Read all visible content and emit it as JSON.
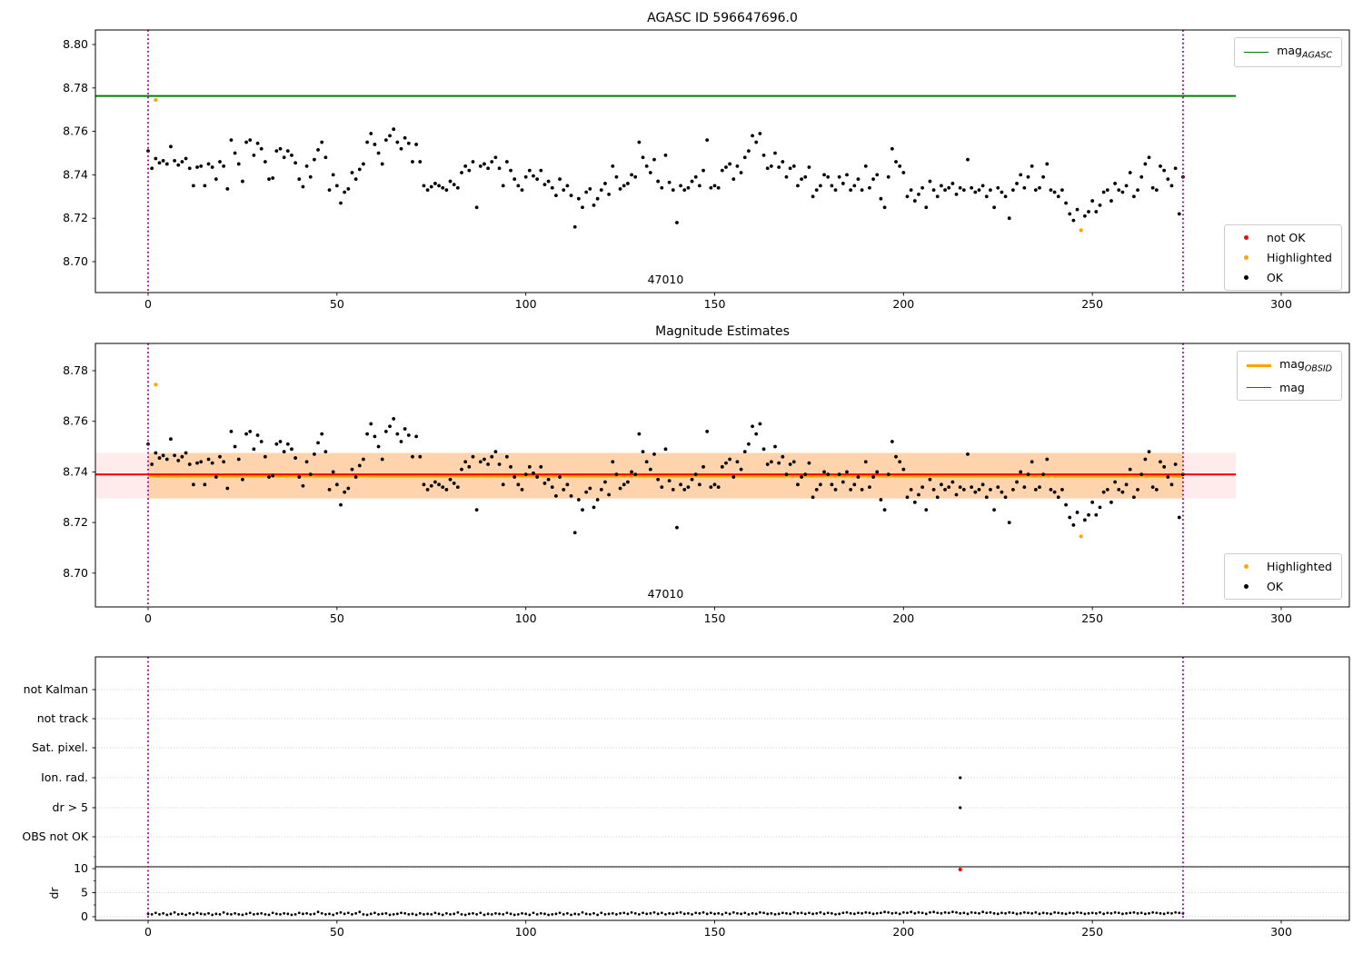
{
  "figure": {
    "background": "#ffffff"
  },
  "colors": {
    "agasc_line": "#007d00",
    "mag_line": "#ff0000",
    "obsid_line": "#ffa500",
    "ok_point": "#000000",
    "not_ok_point": "#ff0000",
    "highlighted_point": "#ffa500",
    "vline": "#990099",
    "band_full": "rgba(255,0,0,0.08)",
    "band_obsid": "rgba(255,160,30,0.30)",
    "grid": "#c8c8c8",
    "threshold_line": "#000000",
    "axis": "#000000"
  },
  "plots": {
    "top": {
      "title": "AGASC ID 596647696.0",
      "obsid_label": {
        "text": "47010",
        "x": 137
      },
      "yticks": [
        "8.70",
        "8.72",
        "8.74",
        "8.76",
        "8.78",
        "8.80"
      ],
      "xticks": [
        0,
        50,
        100,
        150,
        200,
        250,
        300
      ],
      "agasc_line_y": 8.7763,
      "vlines": [
        0,
        274
      ],
      "legend_line": {
        "label": "mag",
        "sub": "AGASC"
      },
      "legend_markers": [
        {
          "label": "not OK",
          "color": "#ff0000"
        },
        {
          "label": "Highlighted",
          "color": "#ffa500"
        },
        {
          "label": "OK",
          "color": "#000000"
        }
      ]
    },
    "middle": {
      "title": "Magnitude Estimates",
      "obsid_label": {
        "text": "47010",
        "x": 137
      },
      "yticks": [
        "8.70",
        "8.72",
        "8.74",
        "8.76",
        "8.78"
      ],
      "xticks": [
        0,
        50,
        100,
        150,
        200,
        250,
        300
      ],
      "mag_line_y": 8.739,
      "obsid_line_y": 8.7384,
      "band": {
        "y_low": 8.7295,
        "y_high": 8.7475
      },
      "vlines": [
        0,
        274
      ],
      "legend_lines": [
        {
          "label": "mag",
          "sub": "OBSID",
          "color": "#ffa500"
        },
        {
          "label": "mag",
          "sub": "",
          "color": "#ff0000"
        }
      ],
      "legend_markers": [
        {
          "label": "Highlighted",
          "color": "#ffa500"
        },
        {
          "label": "OK",
          "color": "#000000"
        }
      ]
    },
    "bottom": {
      "rows": [
        "not Kalman",
        "not track",
        "Sat. pixel.",
        "Ion. rad.",
        "dr > 5",
        "OBS not OK"
      ],
      "dr_ticks": [
        "10",
        "5",
        "0"
      ],
      "dr_axis_label": "dr",
      "xticks": [
        0,
        50,
        100,
        150,
        200,
        250,
        300
      ],
      "vlines": [
        0,
        274
      ]
    }
  },
  "chart_data": {
    "type": "scatter",
    "x_start": 0,
    "x_step": 1,
    "x_end": 274,
    "xlim": [
      -14,
      318
    ],
    "top_ylim": [
      8.686,
      8.807
    ],
    "middle_ylim": [
      8.687,
      8.791
    ],
    "agasc_mag": 8.7763,
    "mag_estimate": 8.739,
    "mag_band": [
      8.7295,
      8.7475
    ],
    "line_x_extent": [
      -14,
      288
    ],
    "obsid_x_extent": [
      0,
      274
    ],
    "mag_y": [
      8.751,
      8.743,
      8.7475,
      8.7455,
      8.7465,
      8.745,
      8.753,
      8.7465,
      8.7445,
      8.746,
      8.7475,
      8.743,
      8.735,
      8.7435,
      8.744,
      8.735,
      8.745,
      8.7435,
      8.738,
      8.746,
      8.744,
      8.7335,
      8.756,
      8.75,
      8.745,
      8.737,
      8.755,
      8.756,
      8.749,
      8.7545,
      8.752,
      8.746,
      8.738,
      8.7385,
      8.751,
      8.752,
      8.748,
      8.751,
      8.749,
      8.7455,
      8.738,
      8.7345,
      8.744,
      8.739,
      8.747,
      8.7515,
      8.755,
      8.748,
      8.733,
      8.74,
      8.735,
      8.727,
      8.732,
      8.7335,
      8.741,
      8.738,
      8.7425,
      8.745,
      8.755,
      8.759,
      8.754,
      8.75,
      8.745,
      8.756,
      8.758,
      8.761,
      8.755,
      8.752,
      8.757,
      8.7545,
      8.746,
      8.754,
      8.746,
      8.735,
      8.733,
      8.7345,
      8.736,
      8.735,
      8.734,
      8.733,
      8.737,
      8.7355,
      8.734,
      8.741,
      8.744,
      8.742,
      8.746,
      8.725,
      8.744,
      8.745,
      8.743,
      8.746,
      8.748,
      8.743,
      8.735,
      8.746,
      8.742,
      8.738,
      8.735,
      8.733,
      8.739,
      8.742,
      8.7395,
      8.738,
      8.742,
      8.7355,
      8.737,
      8.734,
      8.7305,
      8.738,
      8.733,
      8.735,
      8.7305,
      8.716,
      8.729,
      8.725,
      8.732,
      8.7335,
      8.726,
      8.729,
      8.733,
      8.736,
      8.731,
      8.744,
      8.739,
      8.7335,
      8.735,
      8.736,
      8.74,
      8.739,
      8.755,
      8.748,
      8.744,
      8.741,
      8.747,
      8.737,
      8.734,
      8.749,
      8.7365,
      8.733,
      8.718,
      8.735,
      8.733,
      8.734,
      8.737,
      8.739,
      8.735,
      8.742,
      8.756,
      8.734,
      8.735,
      8.734,
      8.742,
      8.7435,
      8.745,
      8.738,
      8.744,
      8.741,
      8.748,
      8.751,
      8.758,
      8.755,
      8.759,
      8.749,
      8.743,
      8.744,
      8.75,
      8.7435,
      8.746,
      8.739,
      8.743,
      8.744,
      8.735,
      8.738,
      8.739,
      8.7435,
      8.73,
      8.733,
      8.735,
      8.74,
      8.739,
      8.735,
      8.733,
      8.739,
      8.736,
      8.74,
      8.733,
      8.735,
      8.738,
      8.733,
      8.744,
      8.734,
      8.738,
      8.74,
      8.729,
      8.725,
      8.739,
      8.752,
      8.746,
      8.744,
      8.741,
      8.73,
      8.733,
      8.728,
      8.731,
      8.734,
      8.725,
      8.737,
      8.733,
      8.73,
      8.735,
      8.733,
      8.734,
      8.736,
      8.731,
      8.734,
      8.733,
      8.747,
      8.734,
      8.732,
      8.733,
      8.735,
      8.73,
      8.733,
      8.725,
      8.734,
      8.732,
      8.73,
      8.72,
      8.733,
      8.736,
      8.74,
      8.734,
      8.739,
      8.744,
      8.733,
      8.734,
      8.739,
      8.745,
      8.733,
      8.732,
      8.73,
      8.733,
      8.727,
      8.722,
      8.719,
      8.724,
      null,
      8.721,
      8.723,
      8.728,
      8.723,
      8.726,
      8.732,
      8.733,
      8.728,
      8.736,
      8.733,
      8.732,
      8.735,
      8.741,
      8.73,
      8.733,
      8.739,
      8.745,
      8.748,
      8.734,
      8.733,
      8.744,
      8.742,
      8.738,
      8.735,
      8.743,
      8.722,
      8.739
    ],
    "highlighted_points": [
      [
        2,
        8.7745
      ],
      [
        247,
        8.7145
      ]
    ],
    "not_ok_points": [],
    "dr_y": [
      0.6,
      0.5,
      0.8,
      0.5,
      0.7,
      0.4,
      0.6,
      0.9,
      0.5,
      0.6,
      0.4,
      0.7,
      0.5,
      0.8,
      0.6,
      0.5,
      0.7,
      0.4,
      0.6,
      0.5,
      0.9,
      0.6,
      0.5,
      0.7,
      0.5,
      0.4,
      0.6,
      0.8,
      0.5,
      0.6,
      0.7,
      0.5,
      0.4,
      0.8,
      0.6,
      0.5,
      0.7,
      0.6,
      0.4,
      0.5,
      0.8,
      0.6,
      0.7,
      0.5,
      0.6,
      1.0,
      0.7,
      0.5,
      0.6,
      0.4,
      0.7,
      0.9,
      0.6,
      0.8,
      0.5,
      0.7,
      1.0,
      0.5,
      0.4,
      0.6,
      0.8,
      0.5,
      0.6,
      0.7,
      0.4,
      0.5,
      0.6,
      0.8,
      0.7,
      0.5,
      0.6,
      0.4,
      0.7,
      0.5,
      0.6,
      0.5,
      0.8,
      0.6,
      0.4,
      0.7,
      0.5,
      0.6,
      0.9,
      0.5,
      0.4,
      0.6,
      0.7,
      0.5,
      0.8,
      0.4,
      0.6,
      0.5,
      0.7,
      0.6,
      0.5,
      0.8,
      0.6,
      0.4,
      0.5,
      0.7,
      0.6,
      0.4,
      0.8,
      0.5,
      0.7,
      0.6,
      0.4,
      0.5,
      0.6,
      0.8,
      0.5,
      0.7,
      0.4,
      0.6,
      0.5,
      0.9,
      0.6,
      0.5,
      0.7,
      0.4,
      0.8,
      0.5,
      0.6,
      0.7,
      0.5,
      0.7,
      0.8,
      0.6,
      0.9,
      0.7,
      0.5,
      0.8,
      0.6,
      0.7,
      0.9,
      0.6,
      0.8,
      0.5,
      0.7,
      0.6,
      0.8,
      0.9,
      0.6,
      0.7,
      0.5,
      0.8,
      0.7,
      0.9,
      0.6,
      0.8,
      0.6,
      0.7,
      0.5,
      0.8,
      0.6,
      0.9,
      0.7,
      0.6,
      0.8,
      0.5,
      0.7,
      0.6,
      0.9,
      0.8,
      0.6,
      0.7,
      0.5,
      0.6,
      0.8,
      0.7,
      0.6,
      0.9,
      0.7,
      0.8,
      0.6,
      0.8,
      0.6,
      0.7,
      0.9,
      0.6,
      0.8,
      0.7,
      0.5,
      0.6,
      0.8,
      0.9,
      0.7,
      0.6,
      0.8,
      0.7,
      0.9,
      0.8,
      0.6,
      0.7,
      0.8,
      1.0,
      0.9,
      0.7,
      0.8,
      0.6,
      0.9,
      0.8,
      1.0,
      0.7,
      0.9,
      0.8,
      0.6,
      0.9,
      1.0,
      0.8,
      0.7,
      0.9,
      0.8,
      1.0,
      0.9,
      0.7,
      0.8,
      0.6,
      0.9,
      0.8,
      0.7,
      1.0,
      0.8,
      0.9,
      0.7,
      0.6,
      0.8,
      0.7,
      0.9,
      0.8,
      0.6,
      0.7,
      0.9,
      0.8,
      0.7,
      0.9,
      0.6,
      0.8,
      0.7,
      0.6,
      0.9,
      0.8,
      0.7,
      0.6,
      0.8,
      0.7,
      0.9,
      0.8,
      0.6,
      0.7,
      0.8,
      0.7,
      0.9,
      0.6,
      0.8,
      0.7,
      0.9,
      0.8,
      0.6,
      0.7,
      0.8,
      0.9,
      0.7,
      0.8,
      0.6,
      0.7,
      0.9,
      0.8,
      0.7,
      0.6,
      0.8,
      0.7,
      0.9,
      0.8,
      0.7
    ],
    "dr_not_ok_points": [
      [
        215,
        10
      ]
    ],
    "dr_threshold": 10,
    "flag_points": [
      {
        "x": 215,
        "row": "Ion. rad."
      },
      {
        "x": 215,
        "row": "dr > 5"
      }
    ]
  }
}
